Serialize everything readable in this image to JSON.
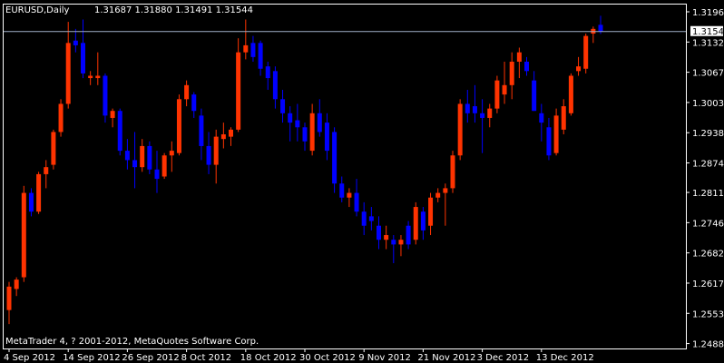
{
  "header": {
    "symbol_timeframe": "EURUSD,Daily",
    "ohlc": "1.31687 1.31880 1.31491 1.31544"
  },
  "footer": {
    "copyright": "MetaTrader 4, ? 2001-2012, MetaQuotes Software Corp."
  },
  "colors": {
    "background": "#000000",
    "frame": "#ffffff",
    "bull_candle": "#ff3300",
    "bear_candle": "#0000ff",
    "text": "#ffffff",
    "price_line": "#a0b0c8"
  },
  "chart_data": {
    "type": "candlestick",
    "symbol": "EURUSD",
    "timeframe": "Daily",
    "current_price": 1.31544,
    "current_price_label": "1.31544",
    "ylim": [
      1.2478,
      1.3212
    ],
    "y_ticks": [
      1.31965,
      1.3132,
      1.30675,
      1.3003,
      1.29385,
      1.2874,
      1.2811,
      1.27465,
      1.2682,
      1.26175,
      1.2553,
      1.24885
    ],
    "y_tick_labels": [
      "1.31965",
      "1.31320",
      "1.30675",
      "1.30030",
      "1.29385",
      "1.28740",
      "1.28110",
      "1.27465",
      "1.26820",
      "1.26175",
      "1.25530",
      "1.24885"
    ],
    "x_labels": [
      {
        "label": "4 Sep 2012",
        "bar": 0
      },
      {
        "label": "14 Sep 2012",
        "bar": 8
      },
      {
        "label": "26 Sep 2012",
        "bar": 16
      },
      {
        "label": "8 Oct 2012",
        "bar": 24
      },
      {
        "label": "18 Oct 2012",
        "bar": 32
      },
      {
        "label": "30 Oct 2012",
        "bar": 40
      },
      {
        "label": "9 Nov 2012",
        "bar": 48
      },
      {
        "label": "21 Nov 2012",
        "bar": 56
      },
      {
        "label": "3 Dec 2012",
        "bar": 64
      },
      {
        "label": "13 Dec 2012",
        "bar": 72
      }
    ],
    "candles": [
      {
        "o": 1.256,
        "h": 1.262,
        "l": 1.253,
        "c": 1.261
      },
      {
        "o": 1.2605,
        "h": 1.263,
        "l": 1.259,
        "c": 1.2625
      },
      {
        "o": 1.263,
        "h": 1.2825,
        "l": 1.262,
        "c": 1.281
      },
      {
        "o": 1.281,
        "h": 1.282,
        "l": 1.276,
        "c": 1.277
      },
      {
        "o": 1.277,
        "h": 1.2855,
        "l": 1.2765,
        "c": 1.285
      },
      {
        "o": 1.285,
        "h": 1.288,
        "l": 1.282,
        "c": 1.2865
      },
      {
        "o": 1.287,
        "h": 1.2945,
        "l": 1.286,
        "c": 1.294
      },
      {
        "o": 1.294,
        "h": 1.301,
        "l": 1.293,
        "c": 1.3
      },
      {
        "o": 1.3,
        "h": 1.3175,
        "l": 1.299,
        "c": 1.313
      },
      {
        "o": 1.3135,
        "h": 1.316,
        "l": 1.311,
        "c": 1.3125
      },
      {
        "o": 1.313,
        "h": 1.318,
        "l": 1.3055,
        "c": 1.3065
      },
      {
        "o": 1.3055,
        "h": 1.307,
        "l": 1.304,
        "c": 1.306
      },
      {
        "o": 1.3055,
        "h": 1.311,
        "l": 1.304,
        "c": 1.306
      },
      {
        "o": 1.306,
        "h": 1.3065,
        "l": 1.296,
        "c": 1.2975
      },
      {
        "o": 1.297,
        "h": 1.299,
        "l": 1.295,
        "c": 1.2985
      },
      {
        "o": 1.2985,
        "h": 1.299,
        "l": 1.289,
        "c": 1.29
      },
      {
        "o": 1.29,
        "h": 1.2925,
        "l": 1.286,
        "c": 1.288
      },
      {
        "o": 1.288,
        "h": 1.294,
        "l": 1.282,
        "c": 1.2865
      },
      {
        "o": 1.2865,
        "h": 1.2925,
        "l": 1.2855,
        "c": 1.291
      },
      {
        "o": 1.291,
        "h": 1.292,
        "l": 1.285,
        "c": 1.286
      },
      {
        "o": 1.286,
        "h": 1.29,
        "l": 1.281,
        "c": 1.284
      },
      {
        "o": 1.2845,
        "h": 1.2895,
        "l": 1.284,
        "c": 1.289
      },
      {
        "o": 1.289,
        "h": 1.292,
        "l": 1.2855,
        "c": 1.29
      },
      {
        "o": 1.2895,
        "h": 1.302,
        "l": 1.289,
        "c": 1.301
      },
      {
        "o": 1.301,
        "h": 1.305,
        "l": 1.2995,
        "c": 1.304
      },
      {
        "o": 1.302,
        "h": 1.3025,
        "l": 1.297,
        "c": 1.2985
      },
      {
        "o": 1.2975,
        "h": 1.299,
        "l": 1.288,
        "c": 1.291
      },
      {
        "o": 1.291,
        "h": 1.294,
        "l": 1.285,
        "c": 1.287
      },
      {
        "o": 1.287,
        "h": 1.2945,
        "l": 1.283,
        "c": 1.293
      },
      {
        "o": 1.2925,
        "h": 1.296,
        "l": 1.2905,
        "c": 1.2935
      },
      {
        "o": 1.293,
        "h": 1.295,
        "l": 1.291,
        "c": 1.2945
      },
      {
        "o": 1.2945,
        "h": 1.314,
        "l": 1.294,
        "c": 1.311
      },
      {
        "o": 1.311,
        "h": 1.318,
        "l": 1.3095,
        "c": 1.3125
      },
      {
        "o": 1.313,
        "h": 1.3145,
        "l": 1.309,
        "c": 1.31
      },
      {
        "o": 1.313,
        "h": 1.3135,
        "l": 1.306,
        "c": 1.3075
      },
      {
        "o": 1.308,
        "h": 1.309,
        "l": 1.303,
        "c": 1.3055
      },
      {
        "o": 1.307,
        "h": 1.308,
        "l": 1.299,
        "c": 1.301
      },
      {
        "o": 1.301,
        "h": 1.303,
        "l": 1.296,
        "c": 1.298
      },
      {
        "o": 1.298,
        "h": 1.2995,
        "l": 1.292,
        "c": 1.296
      },
      {
        "o": 1.2965,
        "h": 1.3,
        "l": 1.292,
        "c": 1.295
      },
      {
        "o": 1.295,
        "h": 1.296,
        "l": 1.29,
        "c": 1.292
      },
      {
        "o": 1.29,
        "h": 1.3,
        "l": 1.289,
        "c": 1.298
      },
      {
        "o": 1.298,
        "h": 1.301,
        "l": 1.293,
        "c": 1.294
      },
      {
        "o": 1.296,
        "h": 1.298,
        "l": 1.288,
        "c": 1.29
      },
      {
        "o": 1.294,
        "h": 1.295,
        "l": 1.281,
        "c": 1.283
      },
      {
        "o": 1.283,
        "h": 1.2845,
        "l": 1.279,
        "c": 1.28
      },
      {
        "o": 1.28,
        "h": 1.282,
        "l": 1.278,
        "c": 1.281
      },
      {
        "o": 1.281,
        "h": 1.284,
        "l": 1.276,
        "c": 1.277
      },
      {
        "o": 1.277,
        "h": 1.279,
        "l": 1.272,
        "c": 1.274
      },
      {
        "o": 1.276,
        "h": 1.278,
        "l": 1.273,
        "c": 1.275
      },
      {
        "o": 1.274,
        "h": 1.276,
        "l": 1.269,
        "c": 1.271
      },
      {
        "o": 1.271,
        "h": 1.274,
        "l": 1.269,
        "c": 1.272
      },
      {
        "o": 1.271,
        "h": 1.272,
        "l": 1.266,
        "c": 1.27
      },
      {
        "o": 1.27,
        "h": 1.272,
        "l": 1.2675,
        "c": 1.271
      },
      {
        "o": 1.274,
        "h": 1.275,
        "l": 1.269,
        "c": 1.27
      },
      {
        "o": 1.271,
        "h": 1.279,
        "l": 1.27,
        "c": 1.278
      },
      {
        "o": 1.277,
        "h": 1.278,
        "l": 1.271,
        "c": 1.273
      },
      {
        "o": 1.274,
        "h": 1.281,
        "l": 1.272,
        "c": 1.28
      },
      {
        "o": 1.28,
        "h": 1.282,
        "l": 1.279,
        "c": 1.281
      },
      {
        "o": 1.281,
        "h": 1.283,
        "l": 1.274,
        "c": 1.282
      },
      {
        "o": 1.282,
        "h": 1.29,
        "l": 1.281,
        "c": 1.289
      },
      {
        "o": 1.289,
        "h": 1.301,
        "l": 1.288,
        "c": 1.3
      },
      {
        "o": 1.3,
        "h": 1.303,
        "l": 1.296,
        "c": 1.298
      },
      {
        "o": 1.2995,
        "h": 1.304,
        "l": 1.296,
        "c": 1.298
      },
      {
        "o": 1.298,
        "h": 1.301,
        "l": 1.2895,
        "c": 1.297
      },
      {
        "o": 1.297,
        "h": 1.3,
        "l": 1.295,
        "c": 1.299
      },
      {
        "o": 1.299,
        "h": 1.306,
        "l": 1.298,
        "c": 1.305
      },
      {
        "o": 1.302,
        "h": 1.309,
        "l": 1.3,
        "c": 1.304
      },
      {
        "o": 1.304,
        "h": 1.311,
        "l": 1.301,
        "c": 1.309
      },
      {
        "o": 1.309,
        "h": 1.312,
        "l": 1.3055,
        "c": 1.311
      },
      {
        "o": 1.309,
        "h": 1.31,
        "l": 1.306,
        "c": 1.307
      },
      {
        "o": 1.305,
        "h": 1.307,
        "l": 1.2985,
        "c": 1.2985
      },
      {
        "o": 1.298,
        "h": 1.3,
        "l": 1.292,
        "c": 1.296
      },
      {
        "o": 1.295,
        "h": 1.297,
        "l": 1.288,
        "c": 1.289
      },
      {
        "o": 1.2895,
        "h": 1.299,
        "l": 1.289,
        "c": 1.2975
      },
      {
        "o": 1.2945,
        "h": 1.301,
        "l": 1.2935,
        "c": 1.2995
      },
      {
        "o": 1.298,
        "h": 1.3065,
        "l": 1.2975,
        "c": 1.306
      },
      {
        "o": 1.307,
        "h": 1.31,
        "l": 1.306,
        "c": 1.308
      },
      {
        "o": 1.3075,
        "h": 1.315,
        "l": 1.3065,
        "c": 1.3145
      },
      {
        "o": 1.315,
        "h": 1.3165,
        "l": 1.313,
        "c": 1.316
      },
      {
        "o": 1.31687,
        "h": 1.3188,
        "l": 1.31491,
        "c": 1.31544
      }
    ]
  }
}
